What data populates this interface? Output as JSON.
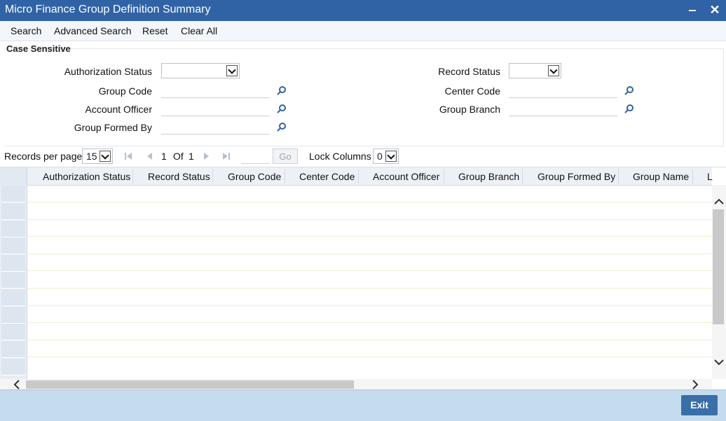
{
  "window": {
    "title": "Micro Finance Group Definition Summary",
    "minimize_glyph": "‒",
    "close_glyph": "✕"
  },
  "toolbar": {
    "search": "Search",
    "advanced_search": "Advanced Search",
    "reset": "Reset",
    "clear_all": "Clear All"
  },
  "criteria": {
    "section_title": "Case Sensitive",
    "authorization_status_label": "Authorization Status",
    "authorization_status_value": "",
    "group_code_label": "Group Code",
    "account_officer_label": "Account Officer",
    "group_formed_by_label": "Group Formed By",
    "record_status_label": "Record Status",
    "record_status_value": "",
    "center_code_label": "Center Code",
    "group_branch_label": "Group Branch"
  },
  "pager": {
    "records_per_page_label": "Records per page",
    "records_per_page_value": "15",
    "current_page": "1",
    "of_label": "Of",
    "total_pages": "1",
    "goto_value": "",
    "go_label": "Go",
    "lock_columns_label": "Lock Columns",
    "lock_columns_value": "0"
  },
  "grid": {
    "columns": [
      "Authorization Status",
      "Record Status",
      "Group Code",
      "Center Code",
      "Account Officer",
      "Group Branch",
      "Group Formed By",
      "Group Name",
      "L"
    ],
    "rows": []
  },
  "footer": {
    "exit_label": "Exit"
  },
  "colors": {
    "titlebar": "#2f63a6",
    "footer": "#c5dcef",
    "exit_button": "#3a6ea8",
    "lookup_icon": "#2f63a6"
  }
}
